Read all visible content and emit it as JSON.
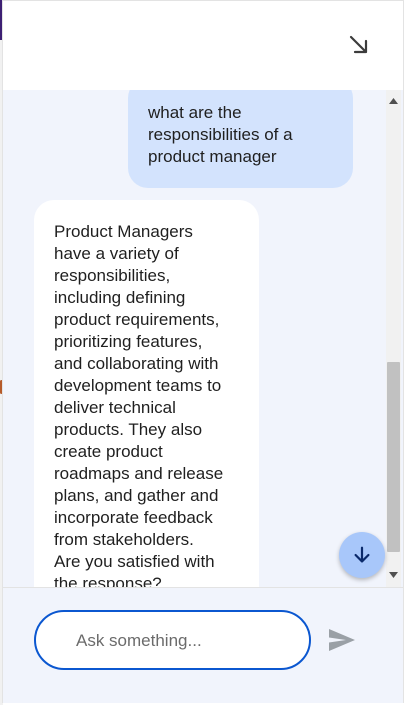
{
  "header": {
    "minimize_icon": "arrow-south-east-icon"
  },
  "chat": {
    "messages": [
      {
        "role": "user",
        "lines": [
          "what are the",
          "responsibilities of a",
          "product manager"
        ]
      },
      {
        "role": "assistant",
        "lines": [
          "Product Managers",
          "have a variety of",
          "responsibilities,",
          "including defining",
          "product requirements,",
          "prioritizing features,",
          "and collaborating with",
          "development teams to",
          "deliver technical",
          "products. They also",
          "create product",
          "roadmaps and release",
          "plans, and gather and",
          "incorporate feedback",
          "from stakeholders.",
          "Are you satisfied with",
          "the response?"
        ]
      }
    ],
    "scroll_down_icon": "arrow-down-icon"
  },
  "composer": {
    "placeholder": "Ask something...",
    "value": "",
    "send_icon": "send-icon"
  },
  "colors": {
    "user_bubble": "#d3e3fd",
    "chat_background": "#f1f4fc",
    "input_border": "#0b57d0",
    "scroll_fab": "#a8c7fa"
  }
}
